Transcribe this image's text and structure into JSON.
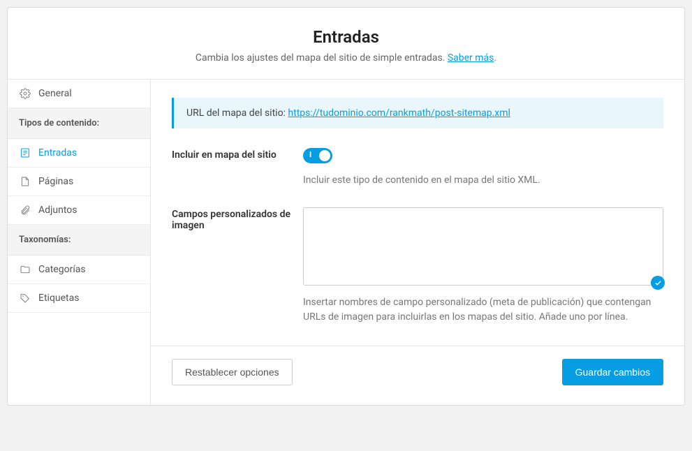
{
  "header": {
    "title": "Entradas",
    "subtitle_prefix": "Cambia los ajustes del mapa del sitio de simple entradas. ",
    "subtitle_link": "Saber más",
    "subtitle_suffix": "."
  },
  "sidebar": {
    "general": "General",
    "group_content": "Tipos de contenido:",
    "entradas": "Entradas",
    "paginas": "Páginas",
    "adjuntos": "Adjuntos",
    "group_tax": "Taxonomías:",
    "categorias": "Categorías",
    "etiquetas": "Etiquetas"
  },
  "notice": {
    "label": "URL del mapa del sitio: ",
    "url": "https://tudominio.com/rankmath/post-sitemap.xml"
  },
  "fields": {
    "include": {
      "label": "Incluir en mapa del sitio",
      "desc": "Incluir este tipo de contenido en el mapa del sitio XML.",
      "value": true
    },
    "custom_image": {
      "label": "Campos personalizados de imagen",
      "value": "",
      "desc": "Insertar nombres de campo personalizado (meta de publicación) que contengan URLs de imagen para incluirlas en los mapas del sitio. Añade uno por línea."
    }
  },
  "footer": {
    "reset": "Restablecer opciones",
    "save": "Guardar cambios"
  }
}
